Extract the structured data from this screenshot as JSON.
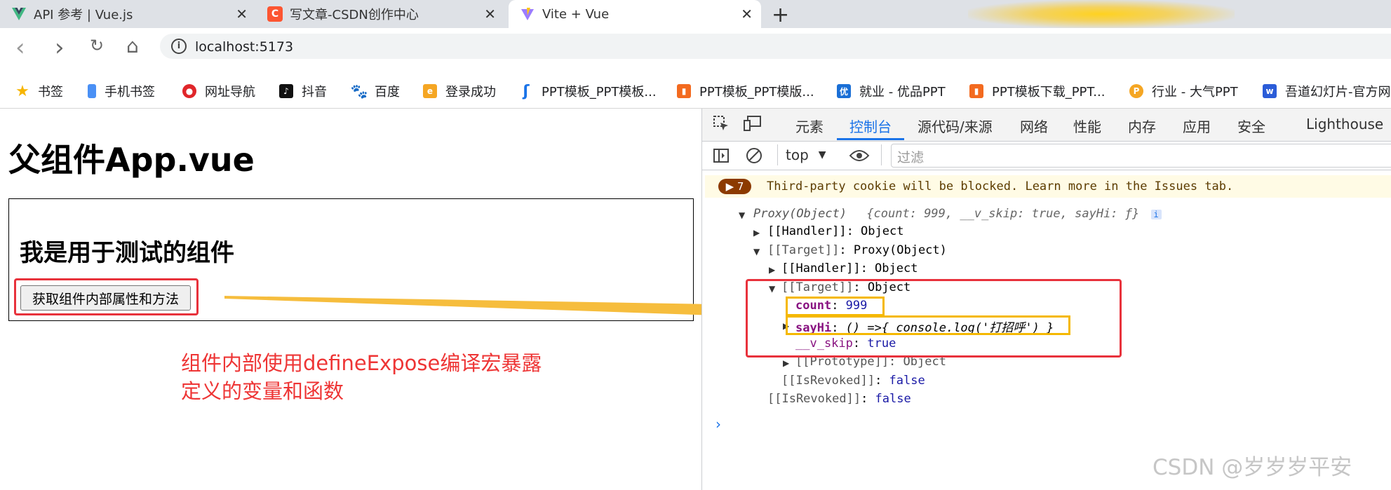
{
  "tabs": [
    {
      "title": "API 参考 | Vue.js",
      "close": "✕",
      "icon": "vue-icon"
    },
    {
      "title": "写文章-CSDN创作中心",
      "close": "✕",
      "icon": "csdn-icon"
    },
    {
      "title": "Vite + Vue",
      "close": "✕",
      "icon": "vite-icon"
    }
  ],
  "new_tab": "+",
  "address": {
    "url": "localhost:5173",
    "info": "i"
  },
  "nav": {
    "back": "‹",
    "forward": "›",
    "reload": "↻",
    "home": "⌂"
  },
  "bookmarks": [
    "书签",
    "手机书签",
    "网址导航",
    "抖音",
    "百度",
    "登录成功",
    "PPT模板_PPT模板...",
    "PPT模板_PPT模版...",
    "就业 - 优品PPT",
    "PPT模板下载_PPT...",
    "行业 - 大气PPT",
    "吾道幻灯片-官方网"
  ],
  "page": {
    "title": "父组件App.vue",
    "child_heading": "我是用于测试的组件",
    "button_label": "获取组件内部属性和方法",
    "annotation_line1": "组件内部使用defineExpose编译宏暴露",
    "annotation_line2": "定义的变量和函数"
  },
  "devtools": {
    "tabs": [
      "元素",
      "控制台",
      "源代码/来源",
      "网络",
      "性能",
      "内存",
      "应用",
      "安全",
      "Lighthouse"
    ],
    "active_tab": "控制台",
    "context": "top",
    "filter_placeholder": "过滤",
    "issues_count": "▶ 7",
    "warning": "Third-party cookie will be blocked. Learn more in the Issues tab.",
    "console": {
      "proxy_label": "Proxy(Object)",
      "proxy_preview": "{count: 999, __v_skip: true, sayHi: ƒ}",
      "info_badge": "i",
      "handler1": "[[Handler]]: Object",
      "target1_key": "[[Target]]",
      "target1_val": ": Proxy(Object)",
      "handler2": "[[Handler]]: Object",
      "target2_key": "[[Target]]",
      "target2_val": ": Object",
      "count_key": "count",
      "count_val": "999",
      "sayhi_key": "sayHi",
      "sayhi_val": "() =>{ console.log('打招呼') }",
      "vskip_key": "__v_skip",
      "vskip_val": "true",
      "prototype": "[[Prototype]]: Object",
      "revoked_inner_key": "[[IsRevoked]]",
      "revoked_inner_val": "false",
      "revoked_outer_key": "[[IsRevoked]]",
      "revoked_outer_val": "false"
    },
    "prompt": "›"
  },
  "watermark": "CSDN @岁岁岁平安",
  "colors": {
    "red_box": "#e8323c",
    "yellow_box": "#f5b800",
    "annotation": "#ee3535",
    "arrow": "#f6bd3d",
    "devtools_accent": "#1a73e8"
  }
}
